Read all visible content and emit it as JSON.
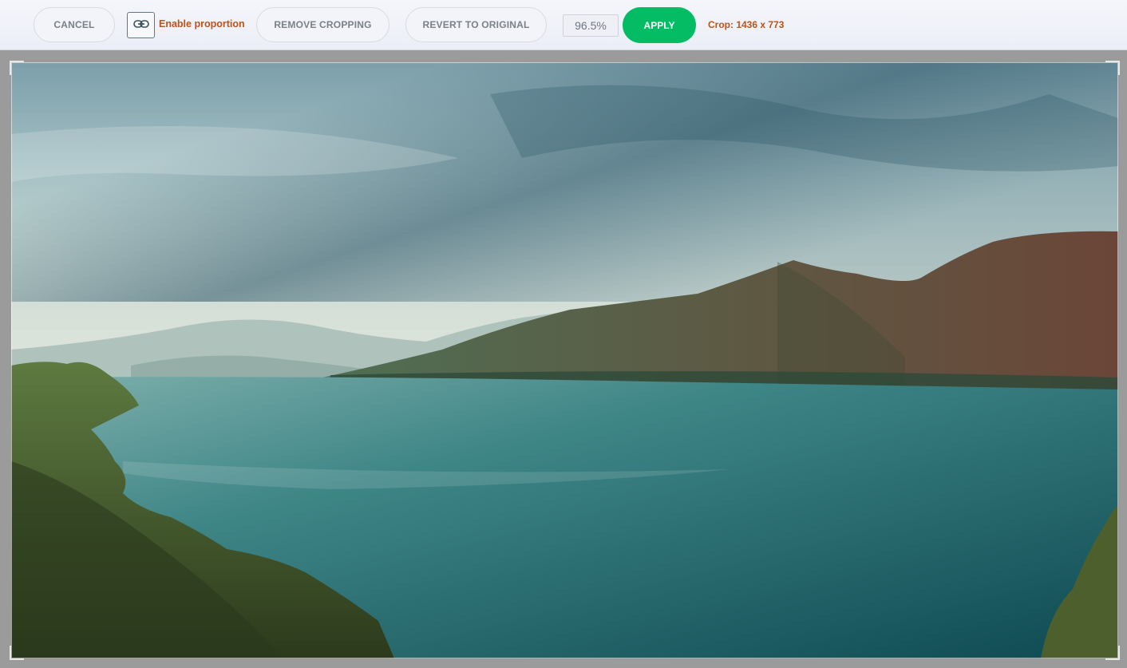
{
  "toolbar": {
    "cancel_label": "CANCEL",
    "proportion_icon": "link-icon",
    "enable_proportion_label": "Enable proportion",
    "remove_cropping_label": "REMOVE CROPPING",
    "revert_label": "REVERT TO ORIGINAL",
    "zoom_value": "96.5%",
    "apply_label": "APPLY",
    "crop_info": "Crop: 1436 x 773"
  },
  "colors": {
    "apply": "#04bc64",
    "accent_text": "#b9541b",
    "canvas_bg": "#9b9b9b"
  }
}
